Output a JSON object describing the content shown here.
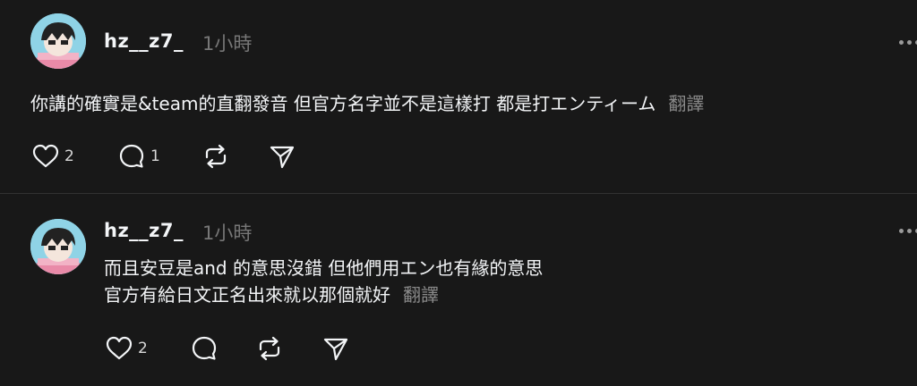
{
  "posts": [
    {
      "username": "hz__z7_",
      "time": "1小時",
      "text_lines": [
        "你講的確實是&team的直翻發音 但官方名字並不是這樣打 都是打エンティーム"
      ],
      "translate_label": "翻譯",
      "likes": "2",
      "replies": "1",
      "icons": [
        "heart-icon",
        "comment-icon",
        "repost-icon",
        "share-icon"
      ]
    },
    {
      "username": "hz__z7_",
      "time": "1小時",
      "text_lines": [
        "而且安豆是and 的意思沒錯 但他們用エン也有緣的意思",
        "官方有給日文正名出來就以那個就好"
      ],
      "translate_label": "翻譯",
      "likes": "2",
      "replies": "",
      "icons": [
        "heart-icon",
        "comment-icon",
        "repost-icon",
        "share-icon"
      ]
    }
  ],
  "colors": {
    "background": "#181818",
    "text": "#f3f5f7",
    "muted": "#777777",
    "divider": "#323232"
  }
}
